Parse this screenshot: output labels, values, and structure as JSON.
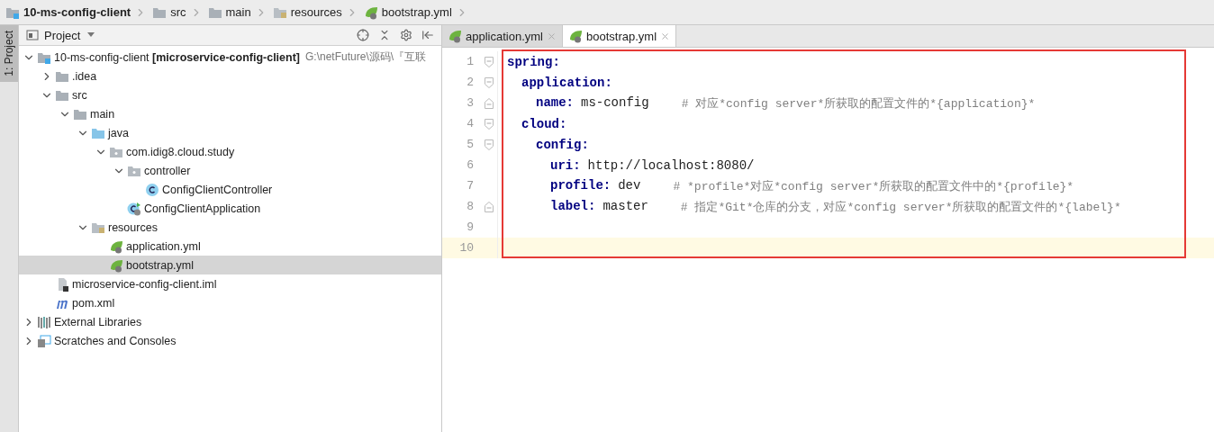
{
  "breadcrumbs": [
    {
      "label": "10-ms-config-client",
      "kind": "module"
    },
    {
      "label": "src",
      "kind": "folder"
    },
    {
      "label": "main",
      "kind": "folder"
    },
    {
      "label": "resources",
      "kind": "resources"
    },
    {
      "label": "bootstrap.yml",
      "kind": "spring"
    }
  ],
  "side_strip": {
    "label": "1: Project"
  },
  "project_panel": {
    "title": "Project",
    "tree": [
      {
        "label": "10-ms-config-client",
        "module": "[microservice-config-client]",
        "path": "G:\\netFuture\\源码\\『互联",
        "kind": "module",
        "expanded": true,
        "selected": false,
        "children": [
          {
            "label": ".idea",
            "kind": "folder",
            "expanded": false,
            "selected": false
          },
          {
            "label": "src",
            "kind": "folder",
            "expanded": true,
            "selected": false,
            "children": [
              {
                "label": "main",
                "kind": "folder",
                "expanded": true,
                "selected": false,
                "children": [
                  {
                    "label": "java",
                    "kind": "source",
                    "expanded": true,
                    "selected": false,
                    "children": [
                      {
                        "label": "com.idig8.cloud.study",
                        "kind": "package",
                        "expanded": true,
                        "selected": false,
                        "children": [
                          {
                            "label": "controller",
                            "kind": "package",
                            "expanded": true,
                            "selected": false,
                            "children": [
                              {
                                "label": "ConfigClientController",
                                "kind": "class",
                                "selected": false
                              }
                            ]
                          },
                          {
                            "label": "ConfigClientApplication",
                            "kind": "boot-class",
                            "selected": false
                          }
                        ]
                      }
                    ]
                  },
                  {
                    "label": "resources",
                    "kind": "resources",
                    "expanded": true,
                    "selected": false,
                    "children": [
                      {
                        "label": "application.yml",
                        "kind": "spring",
                        "selected": false
                      },
                      {
                        "label": "bootstrap.yml",
                        "kind": "spring",
                        "selected": true
                      }
                    ]
                  }
                ]
              }
            ]
          },
          {
            "label": "microservice-config-client.iml",
            "kind": "iml",
            "selected": false
          },
          {
            "label": "pom.xml",
            "kind": "maven",
            "selected": false
          }
        ]
      },
      {
        "label": "External Libraries",
        "kind": "libraries",
        "expanded": false,
        "selected": false
      },
      {
        "label": "Scratches and Consoles",
        "kind": "scratches",
        "expanded": false,
        "selected": false
      }
    ]
  },
  "editor": {
    "tabs": [
      {
        "label": "application.yml",
        "selected": false
      },
      {
        "label": "bootstrap.yml",
        "selected": true
      }
    ],
    "lines": [
      {
        "number": "1",
        "kind": "fold-start",
        "key": "spring:",
        "children": [
          {
            "number": "2",
            "kind": "fold-start",
            "key": "application:",
            "children": [
              {
                "number": "3",
                "kind": "fold-end",
                "key": "name:",
                "value": "ms-config",
                "comment": "# 对应*config server*所获取的配置文件的*{application}*"
              }
            ]
          },
          {
            "number": "4",
            "kind": "fold-start",
            "key": "cloud:",
            "children": [
              {
                "number": "5",
                "kind": "fold-start",
                "key": "config:",
                "children": [
                  {
                    "number": "6",
                    "kind": "plain",
                    "key": "uri:",
                    "value": "http://localhost:8080/"
                  },
                  {
                    "number": "7",
                    "kind": "plain",
                    "key": "profile:",
                    "value": "dev",
                    "comment": "# *profile*对应*config server*所获取的配置文件中的*{profile}*"
                  },
                  {
                    "number": "8",
                    "kind": "fold-end",
                    "key": "label:",
                    "value": "master",
                    "comment": "# 指定*Git*仓库的分支，对应*config server*所获取的配置文件的*{label}*"
                  }
                ]
              }
            ]
          }
        ]
      },
      {
        "number": "9",
        "kind": "blank",
        "current": false
      },
      {
        "number": "10",
        "kind": "blank",
        "current": true
      }
    ]
  }
}
